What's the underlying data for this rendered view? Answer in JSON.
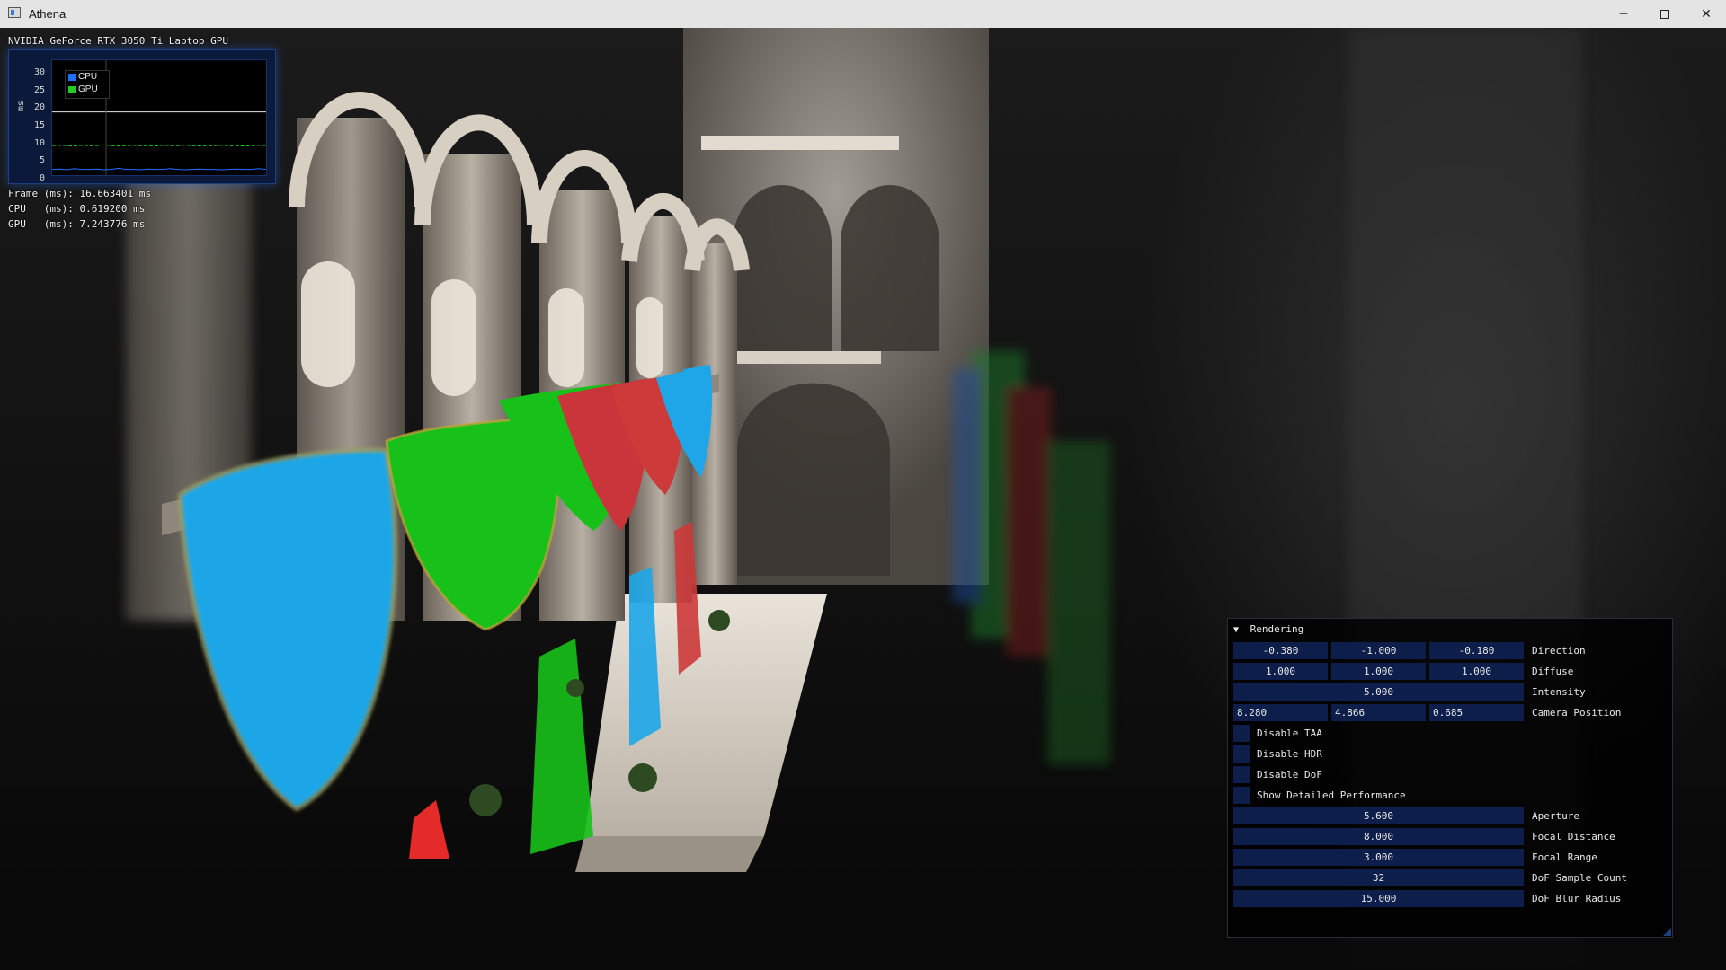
{
  "window": {
    "title": "Athena",
    "minimize_glyph": "─",
    "close_glyph": "✕"
  },
  "overlay": {
    "gpu_name": "NVIDIA GeForce RTX 3050 Ti Laptop GPU",
    "graph": {
      "y_label": "ms",
      "y_ticks": [
        "30",
        "25",
        "20",
        "15",
        "10",
        "5",
        "0"
      ]
    },
    "stats": {
      "frame": "Frame (ms): 16.663401 ms",
      "cpu": "CPU   (ms): 0.619200 ms",
      "gpu": "GPU   (ms): 7.243776 ms"
    }
  },
  "chart_data": {
    "type": "line",
    "title": "",
    "xlabel": "",
    "ylabel": "ms",
    "ylim": [
      0,
      30
    ],
    "y_ticks": [
      0,
      5,
      10,
      15,
      20,
      25,
      30
    ],
    "legend": "top-left",
    "grid": false,
    "reference_line": 16.6,
    "series": [
      {
        "name": "CPU",
        "color": "#1e6fff",
        "values": [
          0.6,
          0.7,
          0.5,
          0.8,
          0.6,
          0.6,
          0.7,
          0.5,
          0.6,
          0.9,
          0.6,
          0.6,
          0.5,
          0.7,
          0.6,
          0.6,
          0.8,
          0.6,
          0.5,
          0.6,
          0.7,
          0.6,
          0.6,
          0.5,
          0.6,
          0.7,
          0.6,
          0.6,
          0.8,
          0.6
        ]
      },
      {
        "name": "GPU",
        "color": "#22cc22",
        "values": [
          7.2,
          7.3,
          7.2,
          7.1,
          7.3,
          7.2,
          7.2,
          7.4,
          7.2,
          7.1,
          7.2,
          7.3,
          7.2,
          7.2,
          7.1,
          7.3,
          7.2,
          7.2,
          7.3,
          7.2,
          7.1,
          7.2,
          7.2,
          7.3,
          7.2,
          7.2,
          7.1,
          7.2,
          7.3,
          7.2
        ]
      }
    ]
  },
  "panel": {
    "title": "Rendering",
    "direction": {
      "x": "-0.380",
      "y": "-1.000",
      "z": "-0.180",
      "label": "Direction"
    },
    "diffuse": {
      "r": "1.000",
      "g": "1.000",
      "b": "1.000",
      "label": "Diffuse"
    },
    "intensity": {
      "value": "5.000",
      "label": "Intensity"
    },
    "camera": {
      "x": "8.280",
      "y": "4.866",
      "z": "0.685",
      "label": "Camera Position"
    },
    "checkboxes": {
      "taa": "Disable TAA",
      "hdr": "Disable HDR",
      "dof": "Disable DoF",
      "perf": "Show Detailed Performance"
    },
    "aperture": {
      "value": "5.600",
      "label": "Aperture"
    },
    "focal_distance": {
      "value": "8.000",
      "label": "Focal Distance"
    },
    "focal_range": {
      "value": "3.000",
      "label": "Focal Range"
    },
    "dof_samples": {
      "value": "32",
      "label": "DoF Sample Count"
    },
    "dof_blur": {
      "value": "15.000",
      "label": "DoF Blur Radius"
    }
  }
}
